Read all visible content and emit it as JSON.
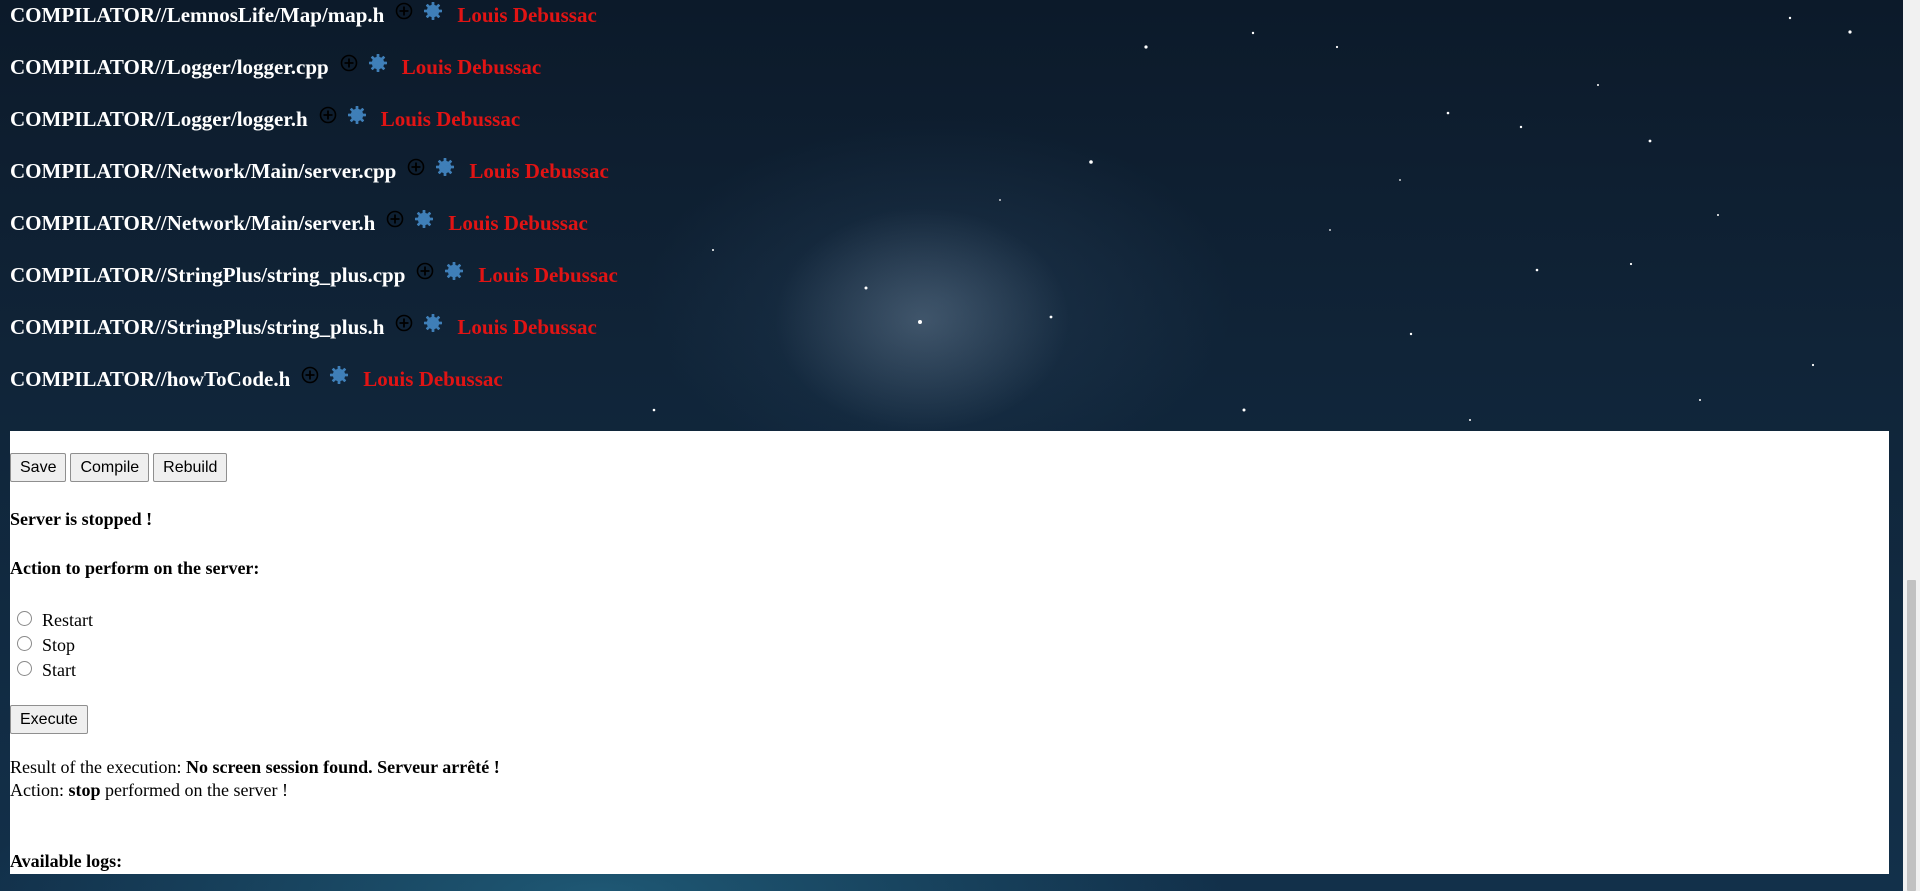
{
  "files": [
    {
      "path": "COMPILATOR//LemnosLife/Map/map.h",
      "author": "Louis Debussac",
      "add_icon": "plus-circle-icon",
      "settings_icon": "gear-icon"
    },
    {
      "path": "COMPILATOR//Logger/logger.cpp",
      "author": "Louis Debussac",
      "add_icon": "plus-circle-icon",
      "settings_icon": "gear-icon"
    },
    {
      "path": "COMPILATOR//Logger/logger.h",
      "author": "Louis Debussac",
      "add_icon": "plus-circle-icon",
      "settings_icon": "gear-icon"
    },
    {
      "path": "COMPILATOR//Network/Main/server.cpp",
      "author": "Louis Debussac",
      "add_icon": "plus-circle-icon",
      "settings_icon": "gear-icon"
    },
    {
      "path": "COMPILATOR//Network/Main/server.h",
      "author": "Louis Debussac",
      "add_icon": "plus-circle-icon",
      "settings_icon": "gear-icon"
    },
    {
      "path": "COMPILATOR//StringPlus/string_plus.cpp",
      "author": "Louis Debussac",
      "add_icon": "plus-circle-icon",
      "settings_icon": "gear-icon"
    },
    {
      "path": "COMPILATOR//StringPlus/string_plus.h",
      "author": "Louis Debussac",
      "add_icon": "plus-circle-icon",
      "settings_icon": "gear-icon"
    },
    {
      "path": "COMPILATOR//howToCode.h",
      "author": "Louis Debussac",
      "add_icon": "plus-circle-icon",
      "settings_icon": "gear-icon"
    }
  ],
  "toolbar": {
    "save_label": "Save",
    "compile_label": "Compile",
    "rebuild_label": "Rebuild"
  },
  "server": {
    "status": "Server is stopped !",
    "action_title": "Action to perform on the server:",
    "options": [
      "Restart",
      "Stop",
      "Start"
    ],
    "execute_label": "Execute",
    "result_prefix": "Result of the execution: ",
    "result_value": "No screen session found. Serveur arrêté !",
    "action_prefix": "Action: ",
    "action_value": "stop",
    "action_suffix": " performed on the server !",
    "logs_title": "Available logs:"
  },
  "colors": {
    "author": "#e11414",
    "gear": "#3f7fb8",
    "background": "#0f2235"
  }
}
